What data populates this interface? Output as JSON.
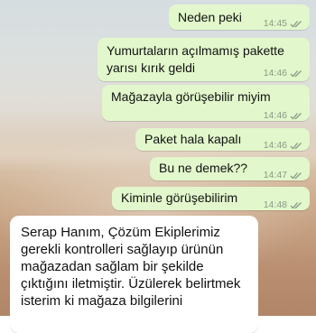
{
  "chat": {
    "outgoing": [
      {
        "lines": [
          "Neden peki"
        ],
        "time": "14:45"
      },
      {
        "lines": [
          "Yumurtaların açılmamış pakette",
          "yarısı kırık geldi"
        ],
        "time": "14:46"
      },
      {
        "lines": [
          "Mağazayla görüşebilir miyim"
        ],
        "time": "14:46"
      },
      {
        "lines": [
          "Paket hala kapalı"
        ],
        "time": "14:46"
      },
      {
        "lines": [
          "Bu ne demek??"
        ],
        "time": "14:47"
      },
      {
        "lines": [
          "Kiminle görüşebilirim"
        ],
        "time": "14:48"
      }
    ],
    "incoming": {
      "lines": [
        "Serap Hanım, Çözüm Ekiplerimiz",
        "gerekli kontrolleri sağlayıp ürünün",
        "mağazadan sağlam bir şekilde",
        "çıktığını iletmiştir. Üzülerek belirtmek",
        "isterim ki mağaza bilgilerini"
      ]
    },
    "colors": {
      "outgoing_bubble": "#e2f7cb",
      "incoming_bubble": "#ffffff",
      "meta_text": "#8a9a86"
    },
    "status_icon": "double-check-icon"
  }
}
